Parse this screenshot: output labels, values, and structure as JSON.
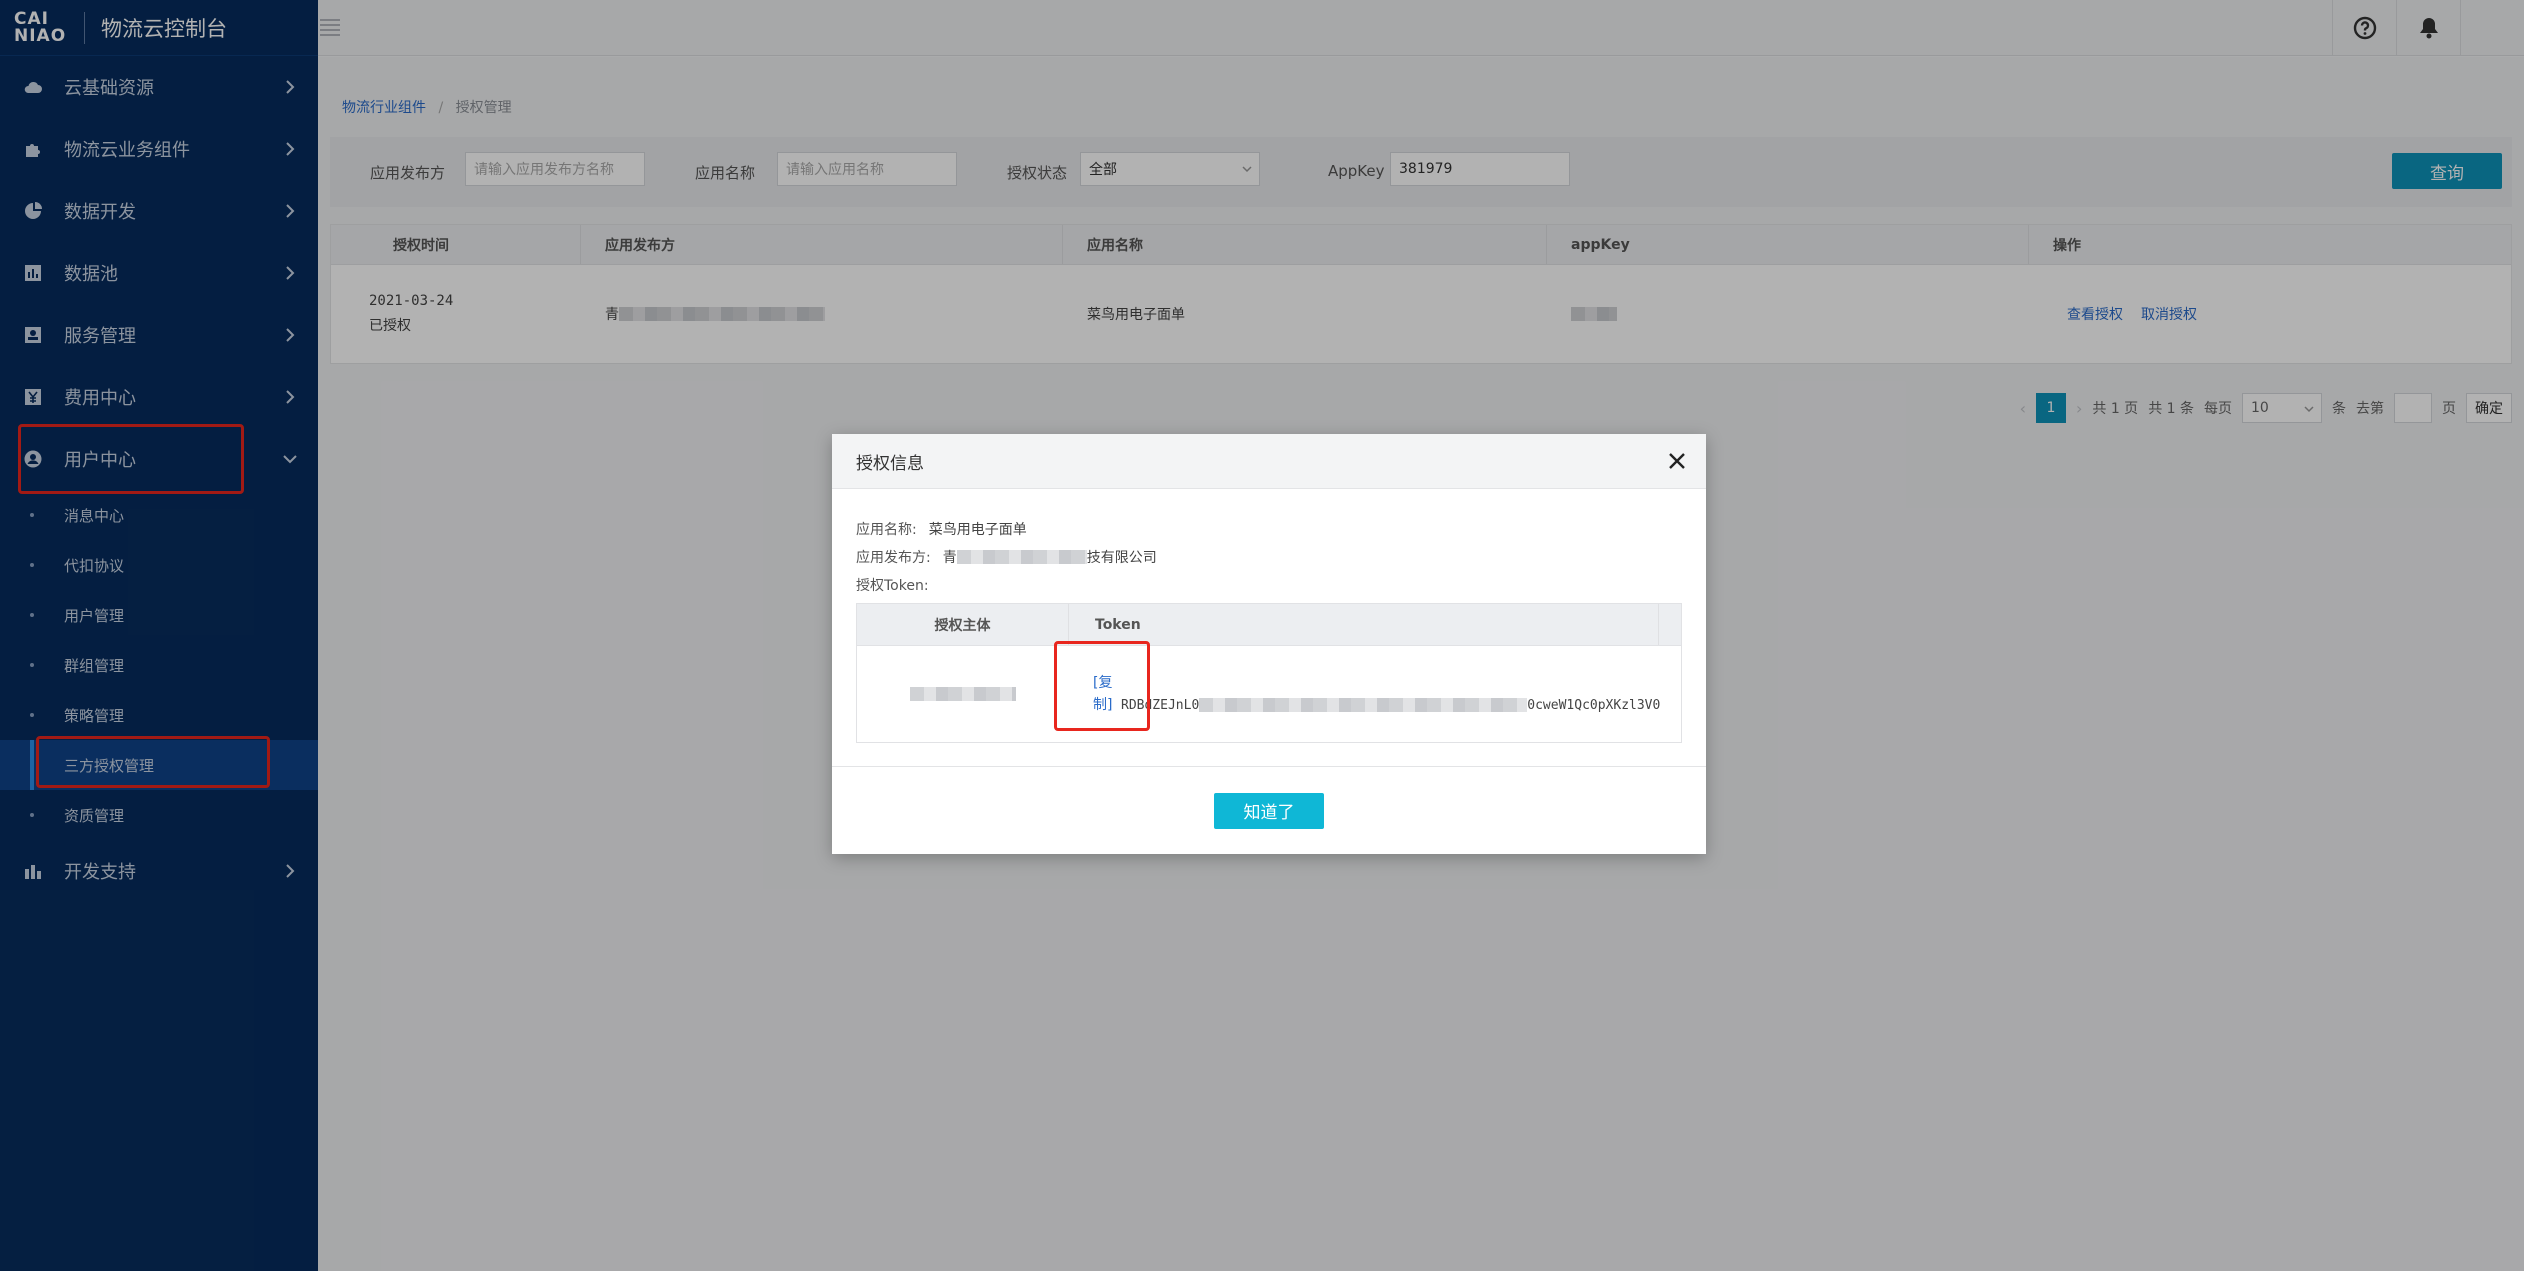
{
  "brand": {
    "logo_line1": "CAI",
    "logo_line2": "NIAO",
    "title": "物流云控制台"
  },
  "sidebar": {
    "items": [
      {
        "label": "云基础资源",
        "icon": "cloud-icon"
      },
      {
        "label": "物流云业务组件",
        "icon": "puzzle-icon"
      },
      {
        "label": "数据开发",
        "icon": "pie-chart-icon"
      },
      {
        "label": "数据池",
        "icon": "bar-chart-icon"
      },
      {
        "label": "服务管理",
        "icon": "service-icon"
      },
      {
        "label": "费用中心",
        "icon": "yen-icon"
      },
      {
        "label": "用户中心",
        "icon": "user-icon"
      }
    ],
    "user_sub": [
      "消息中心",
      "代扣协议",
      "用户管理",
      "群组管理",
      "策略管理",
      "三方授权管理",
      "资质管理"
    ],
    "last_item": {
      "label": "开发支持",
      "icon": "stats-icon"
    }
  },
  "breadcrumb": {
    "parent": "物流行业组件",
    "separator": "/",
    "current": "授权管理"
  },
  "filter": {
    "publisher_label": "应用发布方",
    "publisher_placeholder": "请输入应用发布方名称",
    "app_label": "应用名称",
    "app_placeholder": "请输入应用名称",
    "status_label": "授权状态",
    "status_value": "全部",
    "appkey_label": "AppKey",
    "appkey_value": "381979",
    "query_label": "查询"
  },
  "table": {
    "headers": [
      "授权时间",
      "应用发布方",
      "应用名称",
      "appKey",
      "操作"
    ],
    "row": {
      "date": "2021-03-24",
      "status": "已授权",
      "publisher_prefix": "青",
      "app_name": "菜鸟用电子面单",
      "view_action": "查看授权",
      "cancel_action": "取消授权"
    }
  },
  "pager": {
    "current_page": "1",
    "total_pages_text": "共 1 页",
    "total_items_text": "共 1 条",
    "per_page_label": "每页",
    "per_page_value": "10",
    "per_page_unit": "条",
    "goto_label": "去第",
    "goto_unit": "页",
    "confirm_label": "确定"
  },
  "modal": {
    "title": "授权信息",
    "app_name_label": "应用名称:",
    "app_name_value": "菜鸟用电子面单",
    "publisher_label": "应用发布方:",
    "publisher_prefix": "青",
    "publisher_suffix": "技有限公司",
    "token_label": "授权Token:",
    "col_subject": "授权主体",
    "col_token": "Token",
    "copy_line1": "[复",
    "copy_line2": "制]",
    "token_start": "RDBdZEJnL0",
    "token_end": "0cweW1Qc0pXKzl3V0",
    "ok_label": "知道了"
  },
  "colors": {
    "sidebar_bg": "#072c5d",
    "accent": "#0e93b9",
    "highlight": "#e8261e",
    "link": "#2a6bc9"
  }
}
